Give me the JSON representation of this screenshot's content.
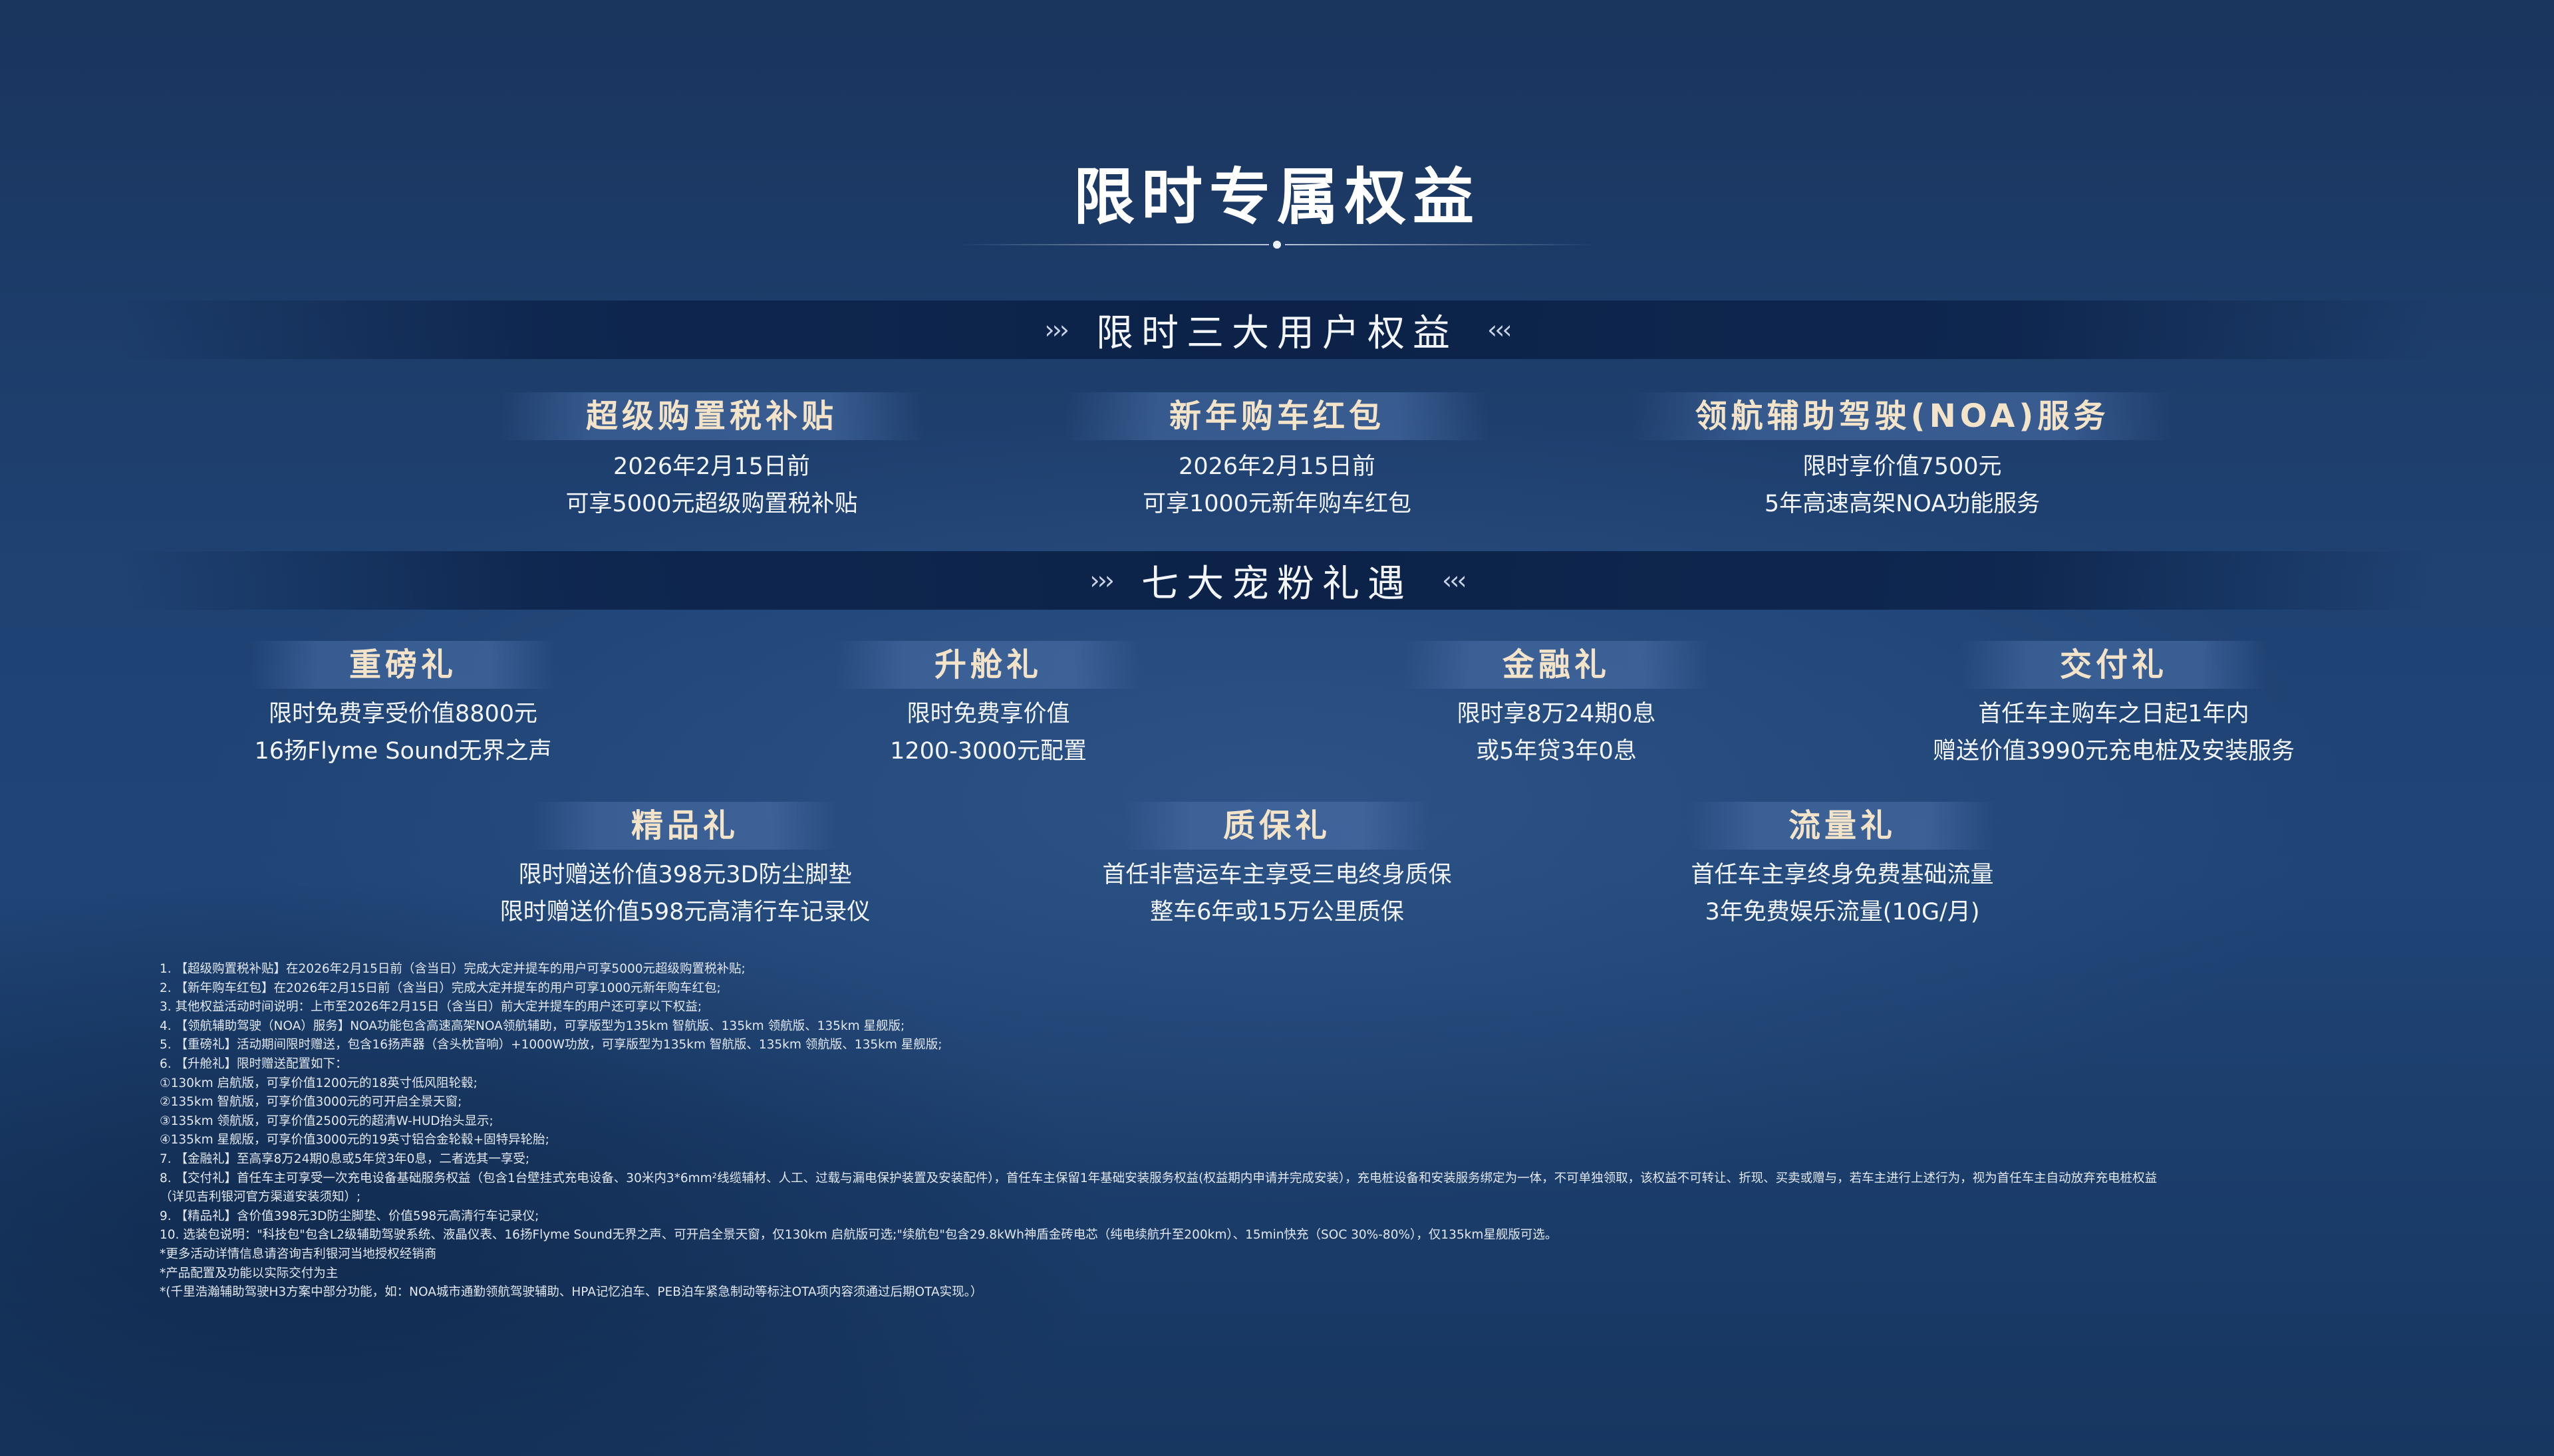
{
  "title": "限时专属权益",
  "sections": {
    "three": {
      "label": "限时三大用户权益",
      "chev_left": "›››",
      "chev_right": "‹‹‹"
    },
    "seven": {
      "label": "七大宠粉礼遇",
      "chev_left": "›››",
      "chev_right": "‹‹‹"
    }
  },
  "benefits": [
    {
      "title": "超级购置税补贴",
      "line1": "2026年2月15日前",
      "line2": "可享5000元超级购置税补贴"
    },
    {
      "title": "新年购车红包",
      "line1": "2026年2月15日前",
      "line2": "可享1000元新年购车红包"
    },
    {
      "title": "领航辅助驾驶(NOA)服务",
      "line1": "限时享价值7500元",
      "line2": "5年高速高架NOA功能服务"
    }
  ],
  "gifts": [
    {
      "title": "重磅礼",
      "line1": "限时免费享受价值8800元",
      "line2": "16扬Flyme Sound无界之声"
    },
    {
      "title": "升舱礼",
      "line1": "限时免费享价值",
      "line2": "1200-3000元配置"
    },
    {
      "title": "金融礼",
      "line1": "限时享8万24期0息",
      "line2": "或5年贷3年0息"
    },
    {
      "title": "交付礼",
      "line1": "首任车主购车之日起1年内",
      "line2": "赠送价值3990元充电桩及安装服务"
    },
    {
      "title": "精品礼",
      "line1": "限时赠送价值398元3D防尘脚垫",
      "line2": "限时赠送价值598元高清行车记录仪"
    },
    {
      "title": "质保礼",
      "line1": "首任非营运车主享受三电终身质保",
      "line2": "整车6年或15万公里质保"
    },
    {
      "title": "流量礼",
      "line1": "首任车主享终身免费基础流量",
      "line2": "3年免费娱乐流量(10G/月)"
    }
  ],
  "footnotes": [
    "1.   【超级购置税补贴】在2026年2月15日前（含当日）完成大定并提车的用户可享5000元超级购置税补贴;",
    "2.   【新年购车红包】在2026年2月15日前（含当日）完成大定并提车的用户可享1000元新年购车红包;",
    "3.   其他权益活动时间说明：上市至2026年2月15日（含当日）前大定并提车的用户还可享以下权益;",
    "4.   【领航辅助驾驶（NOA）服务】NOA功能包含高速高架NOA领航辅助，可享版型为135km 智航版、135km 领航版、135km 星舰版;",
    "5.   【重磅礼】活动期间限时赠送，包含16扬声器（含头枕音响）+1000W功放，可享版型为135km 智航版、135km 领航版、135km 星舰版;",
    "6.   【升舱礼】限时赠送配置如下：",
    "       ①130km 启航版，可享价值1200元的18英寸低风阻轮毂;",
    "       ②135km 智航版，可享价值3000元的可开启全景天窗;",
    "       ③135km 领航版，可享价值2500元的超清W-HUD抬头显示;",
    "       ④135km 星舰版，可享价值3000元的19英寸铝合金轮毂+固特异轮胎;",
    "7.   【金融礼】至高享8万24期0息或5年贷3年0息，二者选其一享受;",
    "8.   【交付礼】首任车主可享受一次充电设备基础服务权益（包含1台壁挂式充电设备、30米内3*6mm²线缆辅材、人工、过载与漏电保护装置及安装配件），首任车主保留1年基础安装服务权益(权益期内申请并完成安装），充电桩设备和安装服务绑定为一体，不可单独领取，该权益不可转让、折现、买卖或赠与，若车主进行上述行为，视为首任车主自动放弃充电桩权益",
    "       （详见吉利银河官方渠道安装须知）;",
    "9.   【精品礼】含价值398元3D防尘脚垫、价值598元高清行车记录仪;",
    "10. 选装包说明：\"科技包\"包含L2级辅助驾驶系统、液晶仪表、16扬Flyme Sound无界之声、可开启全景天窗，仅130km 启航版可选;\"续航包\"包含29.8kWh神盾金砖电芯（纯电续航升至200km）、15min快充（SOC 30%-80%），仅135km星舰版可选。",
    "*更多活动详情信息请咨询吉利银河当地授权经销商",
    "*产品配置及功能以实际交付为主",
    "*(千里浩瀚辅助驾驶H3方案中部分功能，如：NOA城市通勤领航驾驶辅助、HPA记忆泊车、PEB泊车紧急制动等标注OTA项内容须通过后期OTA实现。）"
  ]
}
